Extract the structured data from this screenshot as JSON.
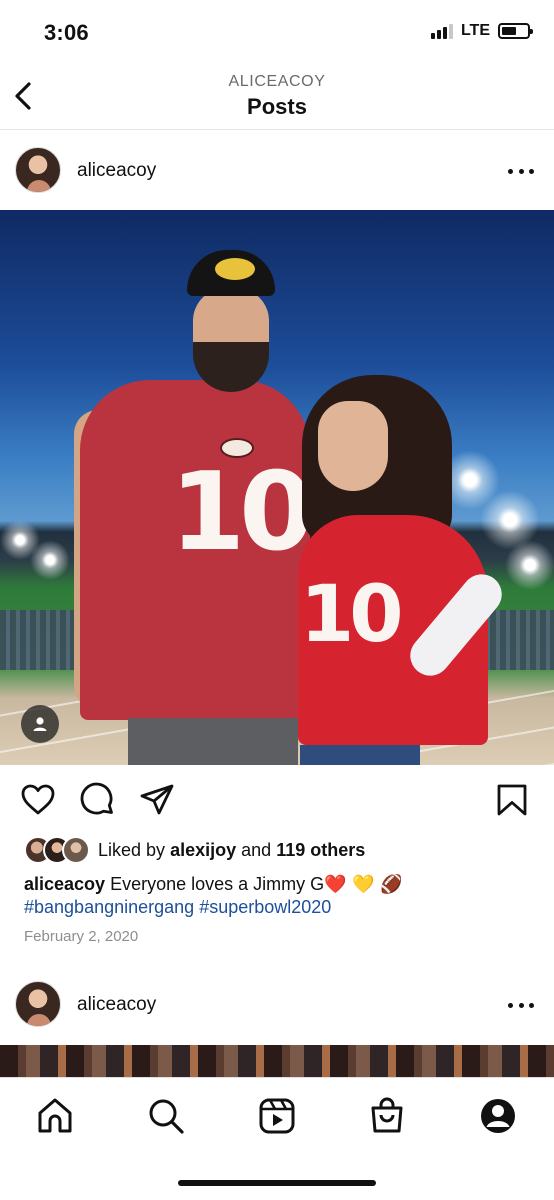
{
  "status_bar": {
    "time": "3:06",
    "network": "LTE",
    "signal_bars_active": 3,
    "signal_bars_total": 4
  },
  "header": {
    "account_label": "ALICEACOY",
    "title": "Posts",
    "back_icon": "chevron-left-icon"
  },
  "post": {
    "username": "aliceacoy",
    "more_icon": "more-horizontal-icon",
    "photo_tag_icon": "user-tag-icon",
    "actions": {
      "like_icon": "heart-icon",
      "comment_icon": "comment-icon",
      "share_icon": "send-icon",
      "save_icon": "bookmark-icon"
    },
    "likes": {
      "prefix": "Liked by",
      "first_liker": "alexijoy",
      "joiner": "and",
      "others": "119 others"
    },
    "caption": {
      "username": "aliceacoy",
      "text": "Everyone loves a Jimmy G",
      "emojis": "❤️ 💛 🏈",
      "hashtags": [
        "#bangbangninergang",
        "#superbowl2020"
      ]
    },
    "date": "February 2, 2020"
  },
  "next_post": {
    "username": "aliceacoy",
    "more_icon": "more-horizontal-icon"
  },
  "bottom_nav": {
    "items": [
      {
        "icon": "home-icon"
      },
      {
        "icon": "search-icon"
      },
      {
        "icon": "reels-icon"
      },
      {
        "icon": "shop-icon"
      },
      {
        "icon": "profile-icon"
      }
    ]
  },
  "colors": {
    "hashtag": "#1d4f9c",
    "heart": "#e0243a",
    "text": "#111111",
    "muted": "#8e8e8e"
  }
}
